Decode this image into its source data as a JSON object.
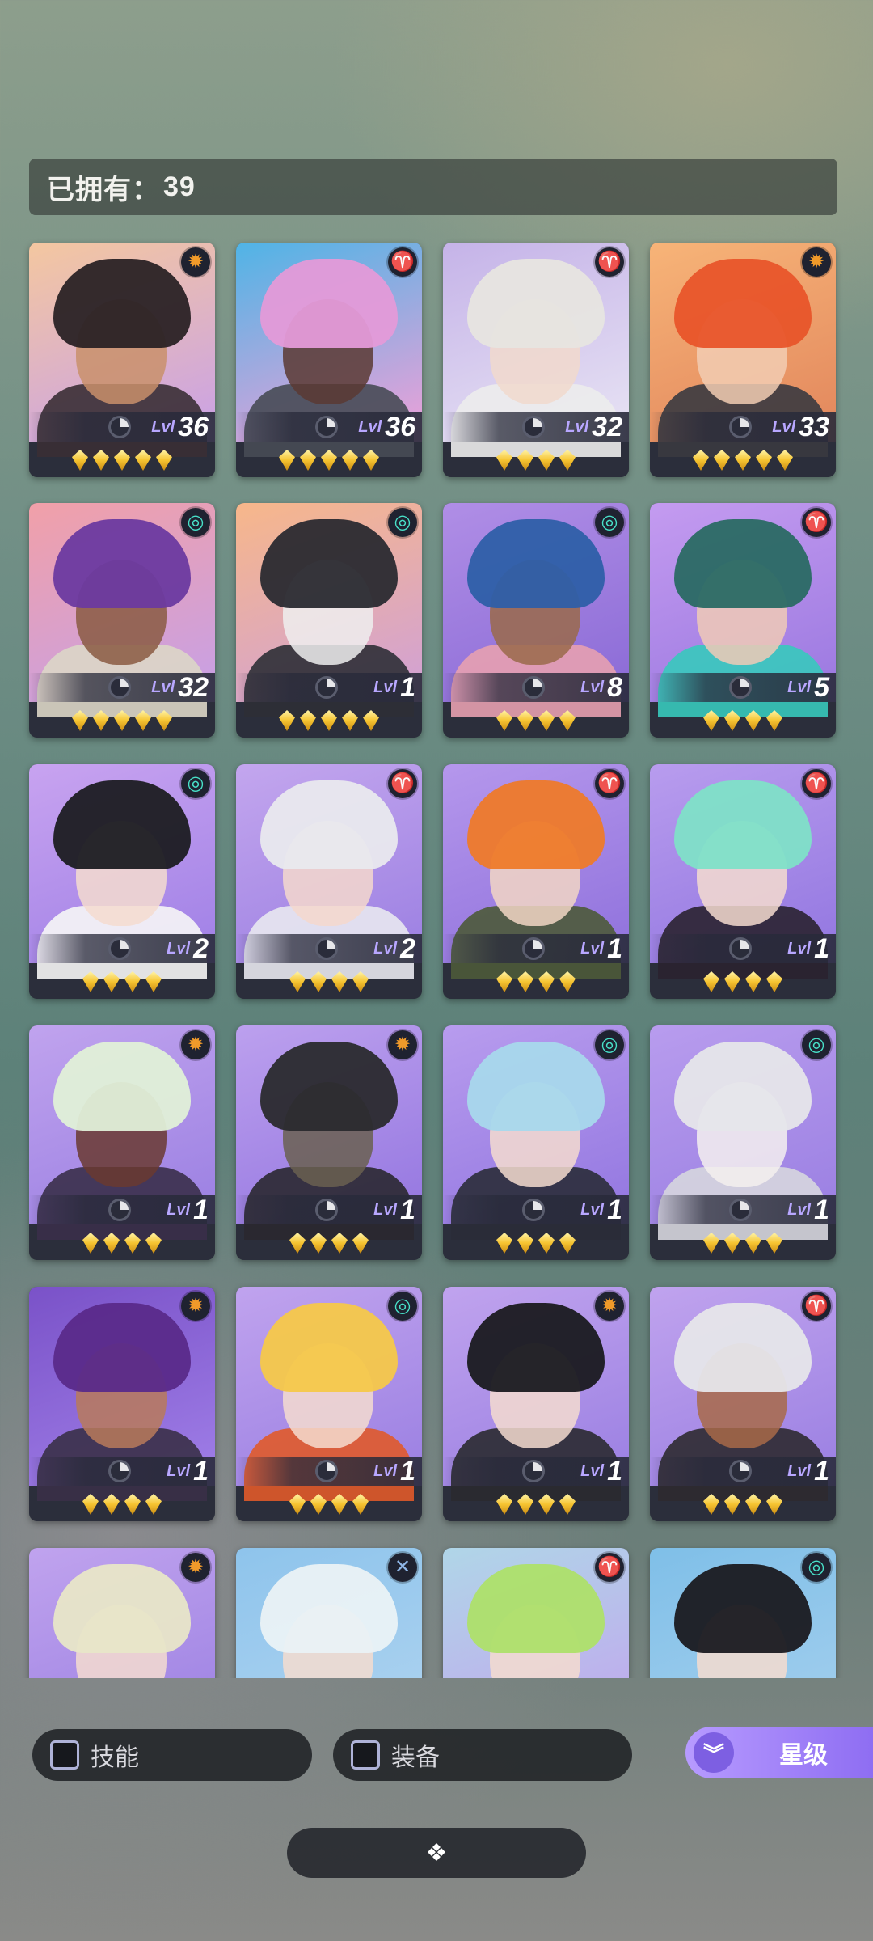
{
  "header": {
    "owned_label": "已拥有：",
    "owned_count": "39"
  },
  "level_prefix": "Lvl",
  "factions": {
    "sun": {
      "icon": "sun-emblem-icon",
      "color": "#f09a2a",
      "glyph": "✹"
    },
    "claw": {
      "icon": "claw-emblem-icon",
      "color": "#d17cf0",
      "glyph": "♈"
    },
    "spiral": {
      "icon": "spiral-emblem-icon",
      "color": "#48e0c8",
      "glyph": "◎"
    },
    "cross": {
      "icon": "cross-emblem-icon",
      "color": "#8fb6e6",
      "glyph": "✕"
    }
  },
  "heroes": [
    {
      "level": "36",
      "stars": 5,
      "faction": "sun",
      "bg": [
        "#f4c7a0",
        "#c9a0e8"
      ],
      "hair": "#2a2225",
      "skin": "#c9906b",
      "outfit": "#3a2f35"
    },
    {
      "level": "36",
      "stars": 5,
      "faction": "claw",
      "bg": [
        "#4fb4e6",
        "#f1a0d8"
      ],
      "hair": "#e49ad8",
      "skin": "#5a3a33",
      "outfit": "#474b55"
    },
    {
      "level": "32",
      "stars": 4,
      "faction": "claw",
      "bg": [
        "#c5b3e8",
        "#e8e4f4"
      ],
      "hair": "#e7e5e0",
      "skin": "#f1d9cc",
      "outfit": "#ececec"
    },
    {
      "level": "33",
      "stars": 5,
      "faction": "sun",
      "bg": [
        "#f7b478",
        "#e2865c"
      ],
      "hair": "#e8552a",
      "skin": "#f2cdb3",
      "outfit": "#3a3a40"
    },
    {
      "level": "32",
      "stars": 5,
      "faction": "spiral",
      "bg": [
        "#f1a0a8",
        "#c6a0e8"
      ],
      "hair": "#6b3aa0",
      "skin": "#8a5a42",
      "outfit": "#dcd6c6"
    },
    {
      "level": "1",
      "stars": 5,
      "faction": "spiral",
      "bg": [
        "#f7b78a",
        "#d0a0d8"
      ],
      "hair": "#2a2a30",
      "skin": "#efefef",
      "outfit": "#2e2f36"
    },
    {
      "level": "8",
      "stars": 4,
      "faction": "spiral",
      "bg": [
        "#b08ee6",
        "#8a6ad6"
      ],
      "hair": "#2e5fa8",
      "skin": "#9a6a4a",
      "outfit": "#e7a0b0"
    },
    {
      "level": "5",
      "stars": 4,
      "faction": "claw",
      "bg": [
        "#c49bf0",
        "#9a78e0"
      ],
      "hair": "#2a6a64",
      "skin": "#f0cab6",
      "outfit": "#37c9bd"
    },
    {
      "level": "2",
      "stars": 4,
      "faction": "spiral",
      "bg": [
        "#c8a3f0",
        "#9f80e6"
      ],
      "hair": "#1c1c22",
      "skin": "#f4dccf",
      "outfit": "#f6f6f6"
    },
    {
      "level": "2",
      "stars": 4,
      "faction": "claw",
      "bg": [
        "#c3a6ee",
        "#9b7fe2"
      ],
      "hair": "#e9e9ee",
      "skin": "#f4d8cc",
      "outfit": "#e8e8f0"
    },
    {
      "level": "1",
      "stars": 4,
      "faction": "claw",
      "bg": [
        "#b597ec",
        "#8f71dc"
      ],
      "hair": "#ee7a2a",
      "skin": "#f2d6c4",
      "outfit": "#4d5a3a"
    },
    {
      "level": "1",
      "stars": 4,
      "faction": "claw",
      "bg": [
        "#b89cee",
        "#9276e0"
      ],
      "hair": "#7fe0c8",
      "skin": "#f4dccf",
      "outfit": "#2a2230"
    },
    {
      "level": "1",
      "stars": 4,
      "faction": "sun",
      "bg": [
        "#c0a3ee",
        "#9a7fe2"
      ],
      "hair": "#e0f0d8",
      "skin": "#6a3a30",
      "outfit": "#3a2f4a"
    },
    {
      "level": "1",
      "stars": 4,
      "faction": "sun",
      "bg": [
        "#bca0ee",
        "#9476e0"
      ],
      "hair": "#2a2a2e",
      "skin": "#6a6050",
      "outfit": "#2a2830"
    },
    {
      "level": "1",
      "stars": 4,
      "faction": "spiral",
      "bg": [
        "#b89cee",
        "#9276e0"
      ],
      "hair": "#a8d8ec",
      "skin": "#f4dccf",
      "outfit": "#2a2c38"
    },
    {
      "level": "1",
      "stars": 4,
      "faction": "spiral",
      "bg": [
        "#b89cee",
        "#9a7fe2"
      ],
      "hair": "#e6e6ea",
      "skin": "#f4f0ee",
      "outfit": "#d6d6de"
    },
    {
      "level": "1",
      "stars": 4,
      "faction": "sun",
      "bg": [
        "#7a52c8",
        "#a07fe8"
      ],
      "hair": "#5a2a8a",
      "skin": "#b87a5a",
      "outfit": "#3a3048"
    },
    {
      "level": "1",
      "stars": 4,
      "faction": "spiral",
      "bg": [
        "#c0a3ee",
        "#9a7fe2"
      ],
      "hair": "#f6c84a",
      "skin": "#f4dccf",
      "outfit": "#e05a2a"
    },
    {
      "level": "1",
      "stars": 4,
      "faction": "sun",
      "bg": [
        "#c0a3ee",
        "#9a7fe2"
      ],
      "hair": "#1a1a20",
      "skin": "#f4dccf",
      "outfit": "#2a2a30"
    },
    {
      "level": "1",
      "stars": 4,
      "faction": "claw",
      "bg": [
        "#c0a3ee",
        "#9a7fe2"
      ],
      "hair": "#e6e6ea",
      "skin": "#a86a48",
      "outfit": "#2e2a30"
    },
    {
      "level": "",
      "stars": 0,
      "faction": "sun",
      "bg": [
        "#c0a3ee",
        "#9a7fe2"
      ],
      "hair": "#e8e6c8",
      "skin": "#f4dccf",
      "outfit": "#e0ddd0"
    },
    {
      "level": "",
      "stars": 0,
      "faction": "cross",
      "bg": [
        "#8ec4ec",
        "#b0d4f0"
      ],
      "hair": "#eaf2f6",
      "skin": "#f4dccf",
      "outfit": "#dfe6f0"
    },
    {
      "level": "",
      "stars": 0,
      "faction": "claw",
      "bg": [
        "#b0d6e8",
        "#c2a3ee"
      ],
      "hair": "#aee06a",
      "skin": "#f4dccf",
      "outfit": "#5a3a6a"
    },
    {
      "level": "",
      "stars": 0,
      "faction": "spiral",
      "bg": [
        "#7fbfe8",
        "#a6d0ee"
      ],
      "hair": "#1a1a20",
      "skin": "#f4dccf",
      "outfit": "#2a2a30"
    }
  ],
  "filters": {
    "skill_label": "技能",
    "equip_label": "装备"
  },
  "sort": {
    "label": "星级",
    "icon": "double-chevron-down-icon"
  },
  "expand": {
    "icon": "diamond-cluster-icon"
  }
}
